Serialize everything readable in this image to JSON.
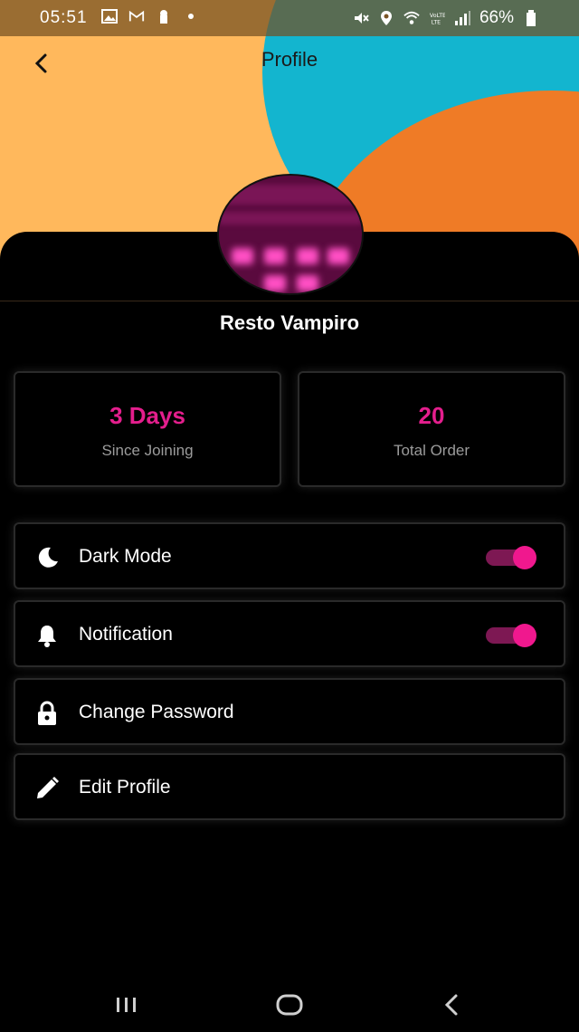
{
  "status_bar": {
    "time": "05:51",
    "battery": "66%",
    "left_icons": [
      "image-icon",
      "gmail-icon",
      "keyhole-icon",
      "dot-icon"
    ],
    "right_icons": [
      "mute-icon",
      "location-icon",
      "wifi-icon",
      "volte-icon",
      "signal-icon",
      "battery-icon"
    ]
  },
  "app_bar": {
    "title": "Profile",
    "back_icon": "chevron-left-icon"
  },
  "profile": {
    "name": "Resto Vampiro"
  },
  "stats": [
    {
      "value": "3 Days",
      "label": "Since Joining"
    },
    {
      "value": "20",
      "label": "Total Order"
    }
  ],
  "settings": [
    {
      "label": "Dark Mode",
      "icon": "moon-icon",
      "toggle": true
    },
    {
      "label": "Notification",
      "icon": "bell-icon",
      "toggle": true
    },
    {
      "label": "Change Password",
      "icon": "lock-icon"
    },
    {
      "label": "Edit Profile",
      "icon": "pencil-icon"
    }
  ],
  "colors": {
    "accent": "#e41e8d",
    "toggle_thumb": "#f0188e",
    "toggle_track": "#7d1853",
    "header_yellow": "#ffb85c",
    "header_teal": "#13b5cf",
    "header_orange": "#ef7b26"
  },
  "nav_bar": [
    "recent-apps-icon",
    "home-icon",
    "back-icon"
  ]
}
